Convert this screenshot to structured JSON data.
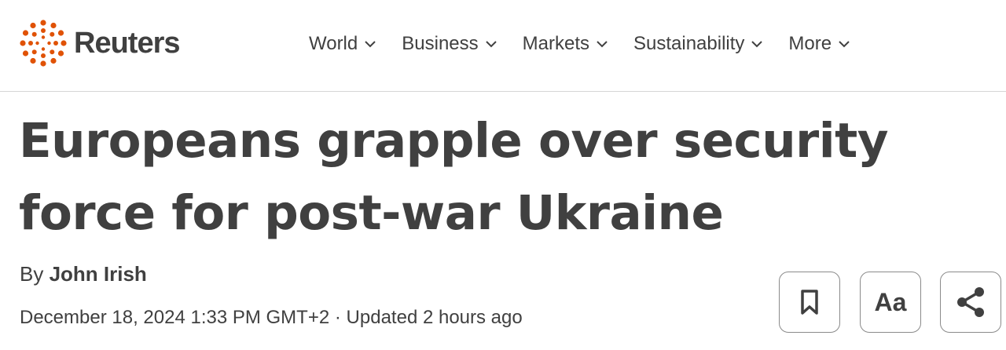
{
  "header": {
    "logo_text": "Reuters",
    "logo_color": "#e05206",
    "nav": [
      {
        "label": "World",
        "icon": "chevron-down-icon"
      },
      {
        "label": "Business",
        "icon": "chevron-down-icon"
      },
      {
        "label": "Markets",
        "icon": "chevron-down-icon"
      },
      {
        "label": "Sustainability",
        "icon": "chevron-down-icon"
      },
      {
        "label": "More",
        "icon": "chevron-down-icon"
      }
    ]
  },
  "article": {
    "headline": "Europeans grapple over security force for post-war Ukraine",
    "byline_prefix": "By",
    "author": "John Irish",
    "published": "December 18, 2024 1:33 PM GMT+2",
    "separator": "·",
    "updated": "Updated 2 hours ago"
  },
  "tools": {
    "bookmark_icon": "bookmark-icon",
    "text_size_label": "Aa",
    "share_icon": "share-icon"
  },
  "colors": {
    "text": "#404040",
    "accent": "#e05206",
    "divider": "#d6d6d6"
  }
}
